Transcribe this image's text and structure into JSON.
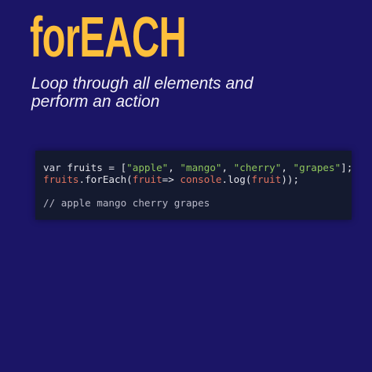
{
  "title": "forEACH",
  "subtitle": "Loop through all elements and perform an action",
  "code": {
    "line1": [
      {
        "t": "var",
        "c": "kw"
      },
      {
        "t": " fruits = [",
        "c": ""
      },
      {
        "t": "\"apple\"",
        "c": "str"
      },
      {
        "t": ", ",
        "c": ""
      },
      {
        "t": "\"mango\"",
        "c": "str"
      },
      {
        "t": ", ",
        "c": ""
      },
      {
        "t": "\"cherry\"",
        "c": "str"
      },
      {
        "t": ", ",
        "c": ""
      },
      {
        "t": "\"grapes\"",
        "c": "str"
      },
      {
        "t": "];",
        "c": ""
      }
    ],
    "line2": [
      {
        "t": "fruits",
        "c": "var"
      },
      {
        "t": ".forEach(",
        "c": ""
      },
      {
        "t": "fruit",
        "c": "var"
      },
      {
        "t": "=> ",
        "c": ""
      },
      {
        "t": "console",
        "c": "var"
      },
      {
        "t": ".log(",
        "c": ""
      },
      {
        "t": "fruit",
        "c": "var"
      },
      {
        "t": "));",
        "c": ""
      }
    ],
    "comment": "// apple mango cherry grapes"
  },
  "colors": {
    "background": "#1b1566",
    "title": "#fdbf3b",
    "code_bg": "#141a2f",
    "string": "#8fc55c",
    "variable": "#e0735e"
  }
}
